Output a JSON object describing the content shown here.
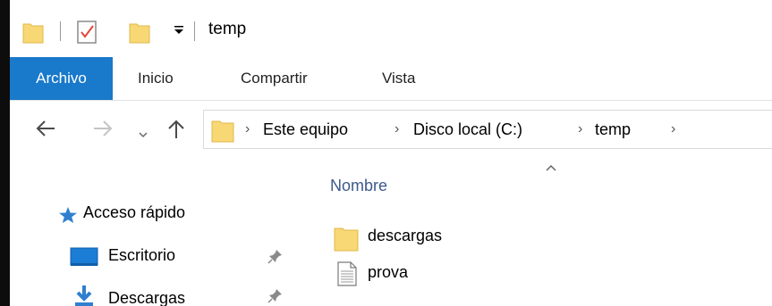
{
  "window": {
    "title": "temp"
  },
  "ribbon": {
    "tabs": [
      {
        "label": "Archivo"
      },
      {
        "label": "Inicio"
      },
      {
        "label": "Compartir"
      },
      {
        "label": "Vista"
      }
    ]
  },
  "address": {
    "crumbs": [
      "Este equipo",
      "Disco local (C:)",
      "temp"
    ]
  },
  "navpane": {
    "quick_access": "Acceso rápido",
    "items": [
      {
        "label": "Escritorio"
      },
      {
        "label": "Descargas"
      }
    ]
  },
  "content": {
    "column_header": "Nombre",
    "files": [
      {
        "name": "descargas",
        "icon": "folder-icon"
      },
      {
        "name": "prova",
        "icon": "text-file-icon"
      }
    ]
  },
  "colors": {
    "accent": "#1979ca",
    "folder": "#f8d775"
  }
}
